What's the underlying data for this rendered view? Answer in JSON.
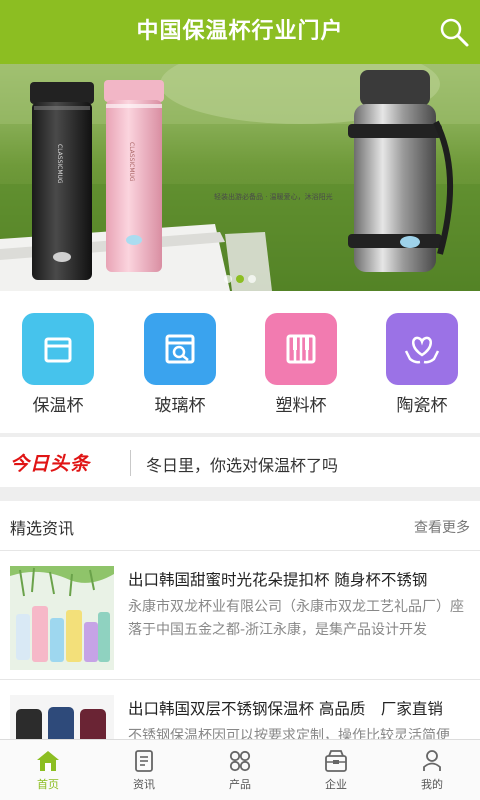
{
  "header": {
    "title": "中国保温杯行业门户",
    "search_icon": "search-icon"
  },
  "banner": {
    "caption": "轻装出游必备品 · 温暖爱心，沐浴阳光",
    "slide_count": 3,
    "active_slide": 1
  },
  "categories": [
    {
      "label": "保温杯",
      "icon": "box-icon",
      "color": "#46c3ec"
    },
    {
      "label": "玻璃杯",
      "icon": "search-box-icon",
      "color": "#3aa3ee"
    },
    {
      "label": "塑料杯",
      "icon": "piano-icon",
      "color": "#f27bb0"
    },
    {
      "label": "陶瓷杯",
      "icon": "heart-hands-icon",
      "color": "#9b72e6"
    }
  ],
  "headline": {
    "logo": "今日头条",
    "text": "冬日里，你选对保温杯了吗"
  },
  "news_section": {
    "title": "精选资讯",
    "more": "查看更多"
  },
  "news": [
    {
      "title": "出口韩国甜蜜时光花朵提扣杯 随身杯不锈钢",
      "desc": "永康市双龙杯业有限公司（永康市双龙工艺礼品厂）座落于中国五金之都-浙江永康，是集产品设计开发"
    },
    {
      "title": "出口韩国双层不锈钢保温杯 高品质　厂家直销",
      "desc": "不锈钢保温杯因可以按要求定制，操作比较灵活简便"
    }
  ],
  "tabbar": [
    {
      "label": "首页",
      "icon": "home-icon",
      "active": true
    },
    {
      "label": "资讯",
      "icon": "news-icon",
      "active": false
    },
    {
      "label": "产品",
      "icon": "grid-icon",
      "active": false
    },
    {
      "label": "企业",
      "icon": "enterprise-icon",
      "active": false
    },
    {
      "label": "我的",
      "icon": "user-icon",
      "active": false
    }
  ],
  "colors": {
    "brand": "#8cbe22",
    "headline_red": "#e01414"
  }
}
